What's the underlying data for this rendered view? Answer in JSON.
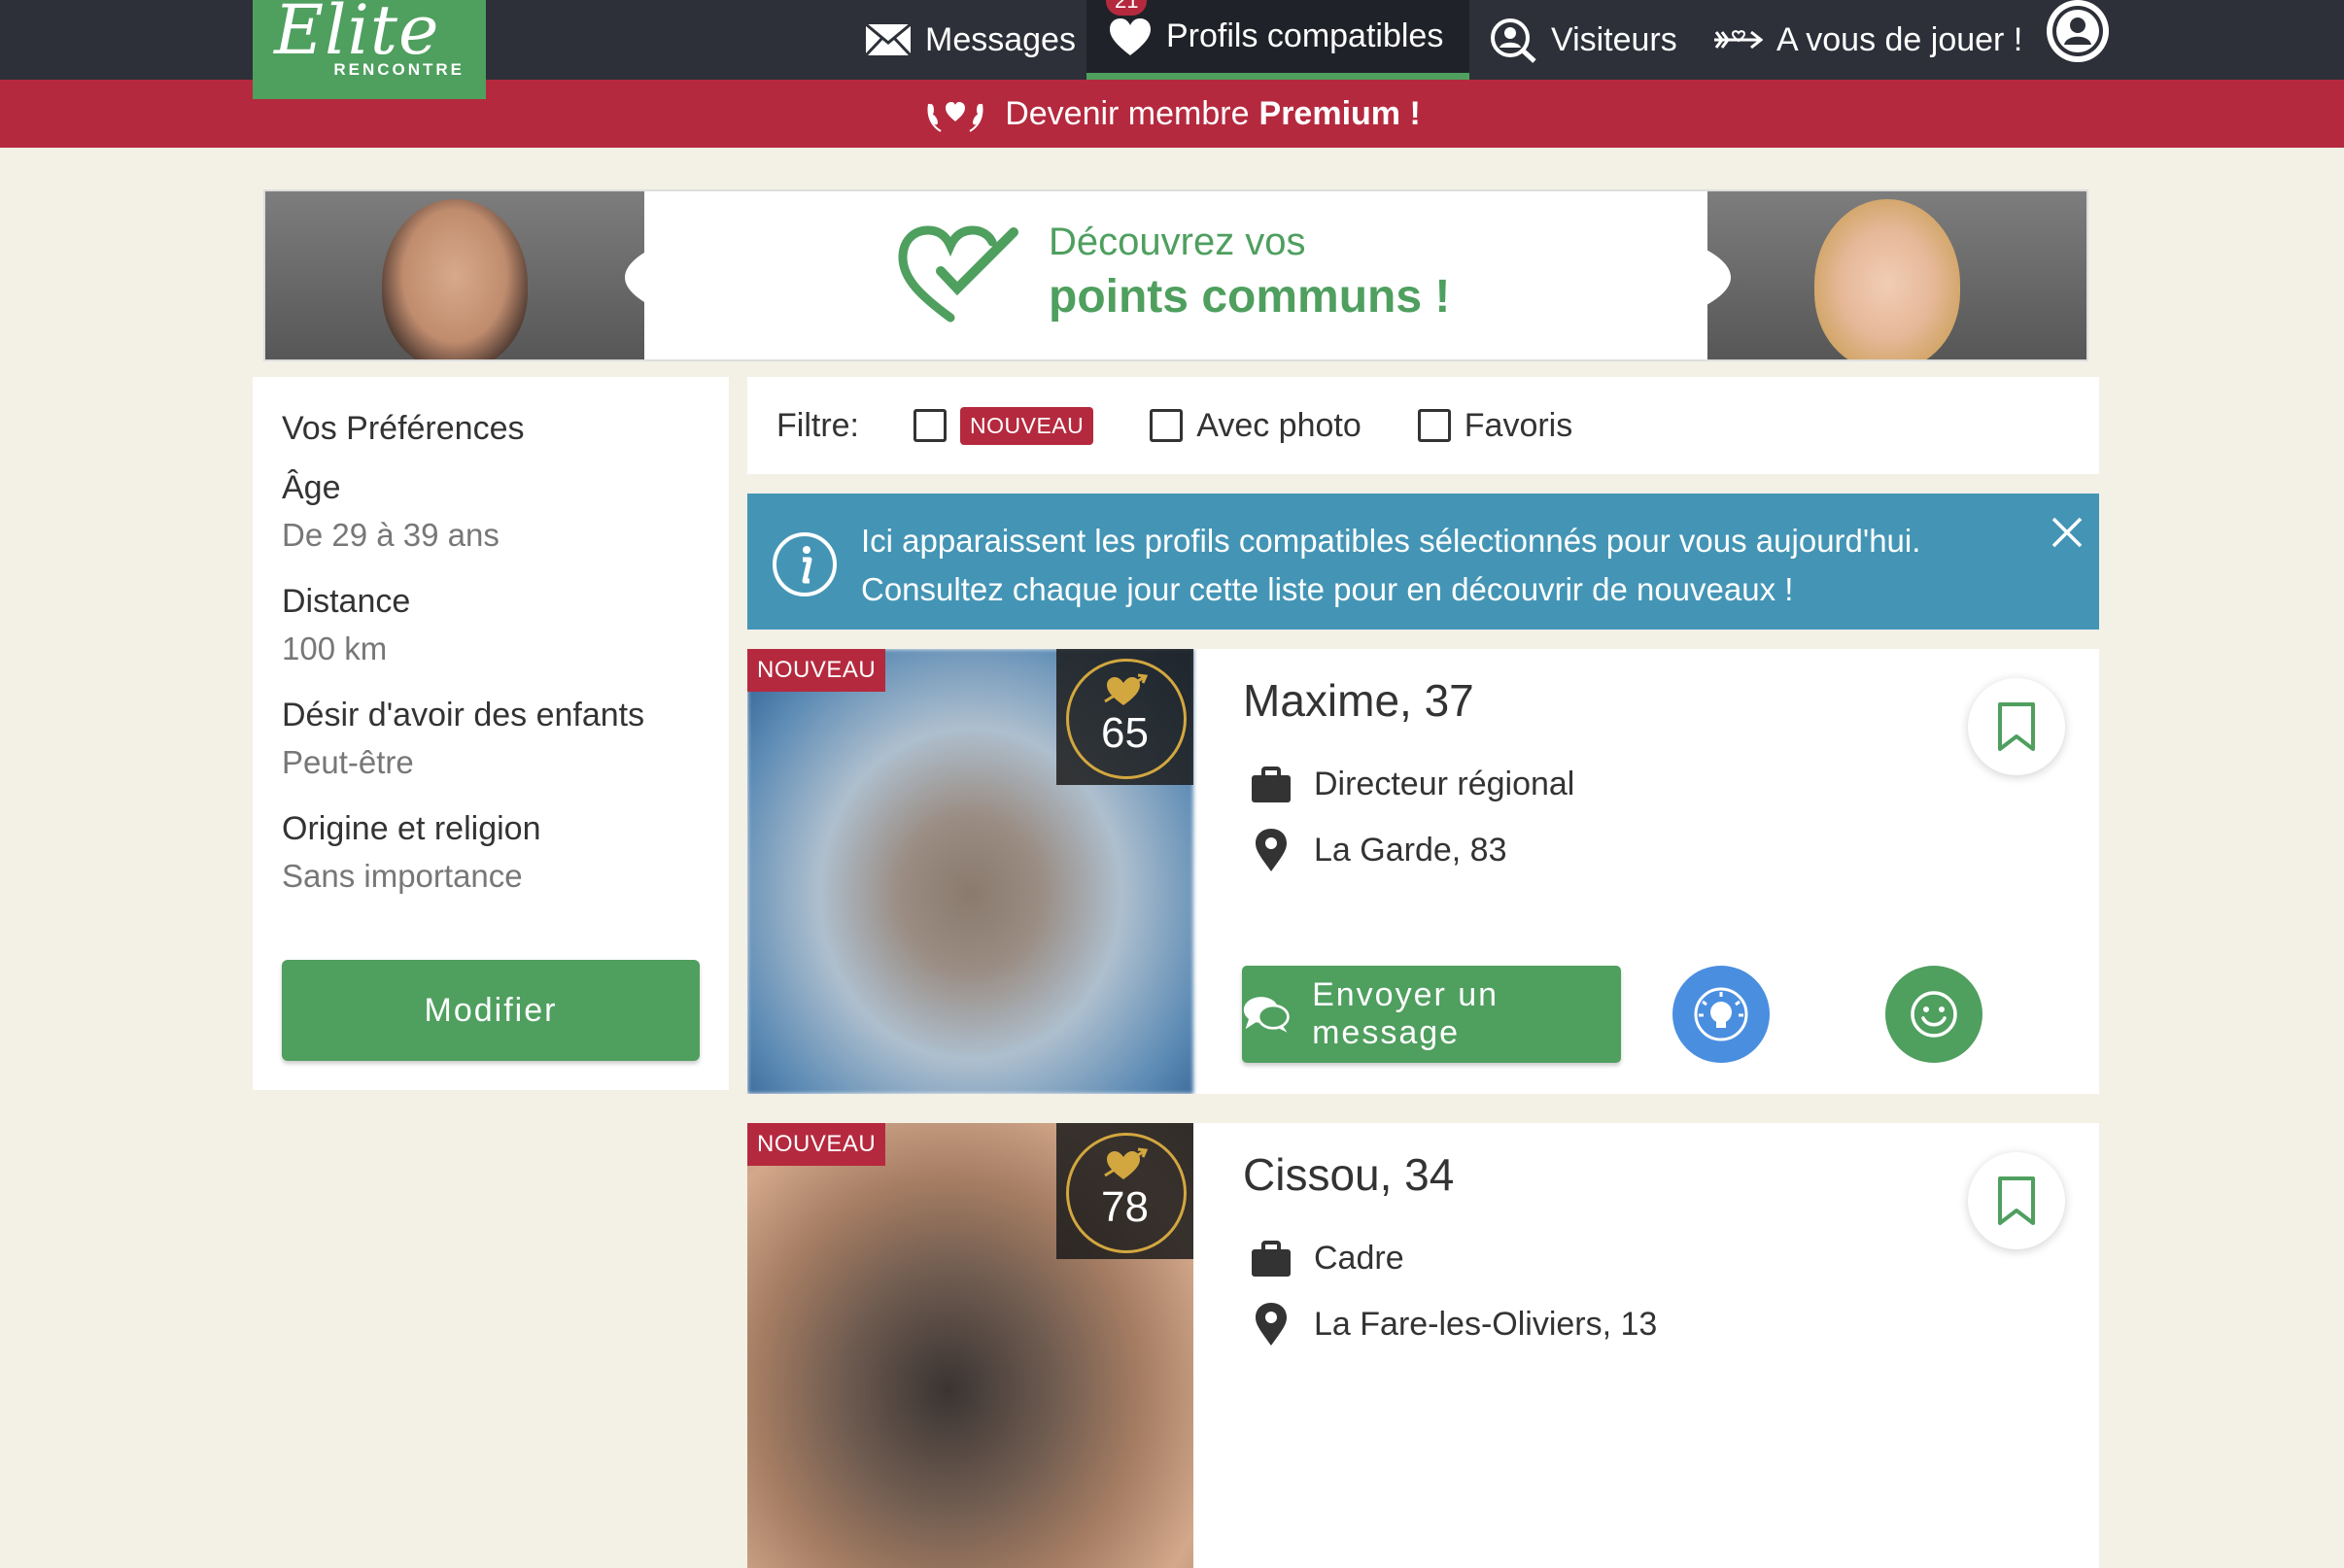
{
  "nav": {
    "logo_script": "Elite",
    "logo_sub": "RENCONTRE",
    "items": [
      {
        "label": "Messages"
      },
      {
        "label": "Profils compatibles",
        "badge": "21"
      },
      {
        "label": "Visiteurs"
      },
      {
        "label": "A vous de jouer !"
      }
    ]
  },
  "premium": {
    "prefix": "Devenir membre",
    "bold": "Premium !"
  },
  "banner": {
    "line1": "Découvrez vos",
    "line2": "points communs !"
  },
  "preferences": {
    "title": "Vos Préférences",
    "items": [
      {
        "label": "Âge",
        "value": "De 29 à 39 ans"
      },
      {
        "label": "Distance",
        "value": "100 km"
      },
      {
        "label": "Désir d'avoir des enfants",
        "value": "Peut-être"
      },
      {
        "label": "Origine et religion",
        "value": "Sans importance"
      }
    ],
    "button": "Modifier"
  },
  "filter": {
    "label": "Filtre:",
    "options": [
      {
        "label": "NOUVEAU",
        "checked": false
      },
      {
        "label": "Avec photo",
        "checked": false
      },
      {
        "label": "Favoris",
        "checked": false
      }
    ]
  },
  "info": {
    "line1": "Ici apparaissent les profils compatibles sélectionnés pour vous aujourd'hui.",
    "line2": "Consultez chaque jour cette liste pour en découvrir de nouveaux !"
  },
  "profiles": [
    {
      "tag": "NOUVEAU",
      "score": "65",
      "name": "Maxime",
      "age": ", 37",
      "job": "Directeur régional",
      "location": "La Garde, 83",
      "message_button": "Envoyer un message"
    },
    {
      "tag": "NOUVEAU",
      "score": "78",
      "name": "Cissou",
      "age": ", 34",
      "job": "Cadre",
      "location": "La Fare-les-Oliviers, 13"
    }
  ],
  "colors": {
    "brand_green": "#4f9f5f",
    "premium_red": "#b5293e",
    "nav_dark": "#2d3038",
    "info_blue": "#4495b5",
    "score_gold": "#d3a73f"
  }
}
